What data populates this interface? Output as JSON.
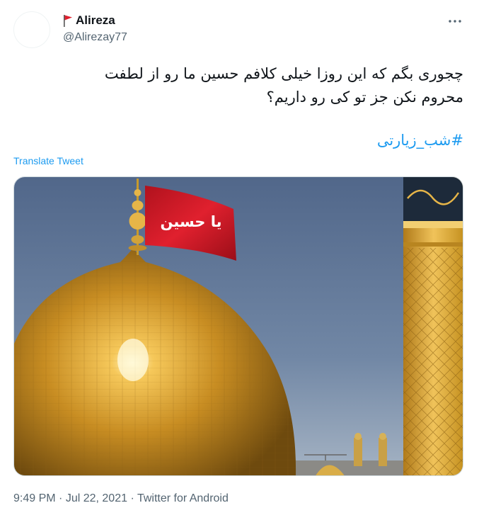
{
  "author": {
    "display_name": "Alireza",
    "handle": "@Alirezay77",
    "name_emoji": "red-flag-icon"
  },
  "tweet": {
    "text_line1": "چجوری بگم که این روزا خیلی کلافم حسین ما رو از لطفت",
    "text_line2": "محروم نکن جز تو کی رو داریم؟",
    "hashtag": "#شب_زیارتی",
    "translate_label": "Translate Tweet"
  },
  "media": {
    "flag_text": "یا حسین",
    "description_icon": "shrine-dome-photo"
  },
  "meta": {
    "time": "9:49 PM",
    "separator": " · ",
    "date": "Jul 22, 2021",
    "source": "Twitter for Android"
  },
  "colors": {
    "link": "#1d9bf0",
    "secondary_text": "#536471",
    "primary_text": "#0f1419"
  }
}
